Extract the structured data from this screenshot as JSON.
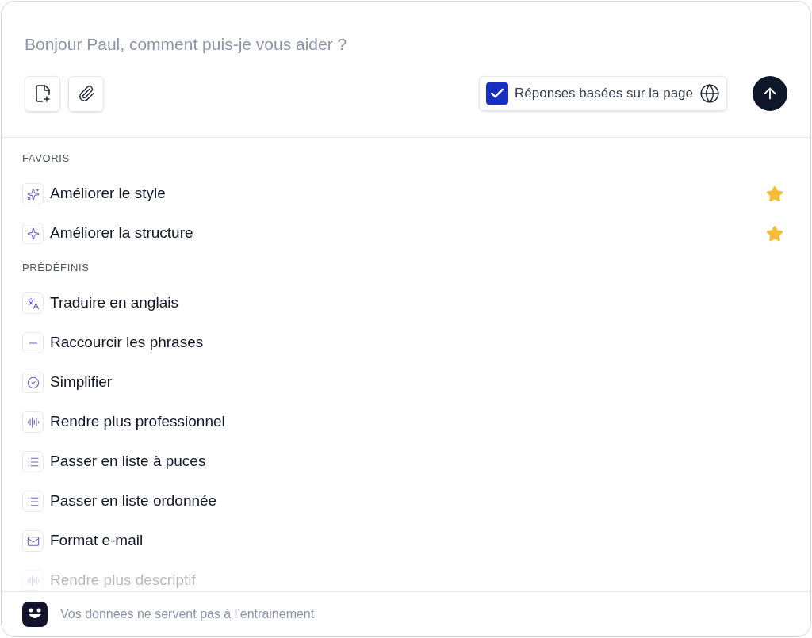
{
  "prompt": {
    "placeholder": "Bonjour Paul, comment puis-je vous aider ?"
  },
  "page_toggle": {
    "label": "Réponses basées sur la page",
    "checked": true
  },
  "sections": [
    {
      "title": "FAVORIS",
      "items": [
        {
          "label": "Améliorer le style",
          "kind": "sparkles",
          "favorite": true,
          "faded": false
        },
        {
          "label": "Améliorer la structure",
          "kind": "sparkle",
          "favorite": true,
          "faded": false
        }
      ]
    },
    {
      "title": "PRÉDÉFINIS",
      "items": [
        {
          "label": "Traduire en anglais",
          "kind": "translate",
          "favorite": false,
          "faded": false
        },
        {
          "label": "Raccourcir les phrases",
          "kind": "lines",
          "favorite": false,
          "faded": false
        },
        {
          "label": "Simplifier",
          "kind": "check",
          "favorite": false,
          "faded": false
        },
        {
          "label": "Rendre plus professionnel",
          "kind": "wave",
          "favorite": false,
          "faded": false
        },
        {
          "label": "Passer en liste à puces",
          "kind": "list",
          "favorite": false,
          "faded": false
        },
        {
          "label": "Passer en liste ordonnée",
          "kind": "list",
          "favorite": false,
          "faded": false
        },
        {
          "label": "Format e-mail",
          "kind": "mail",
          "favorite": false,
          "faded": false
        },
        {
          "label": "Rendre plus descriptif",
          "kind": "wave",
          "favorite": false,
          "faded": true
        }
      ]
    }
  ],
  "footer": {
    "text": "Vos données ne servent pas à l’entrainement"
  }
}
